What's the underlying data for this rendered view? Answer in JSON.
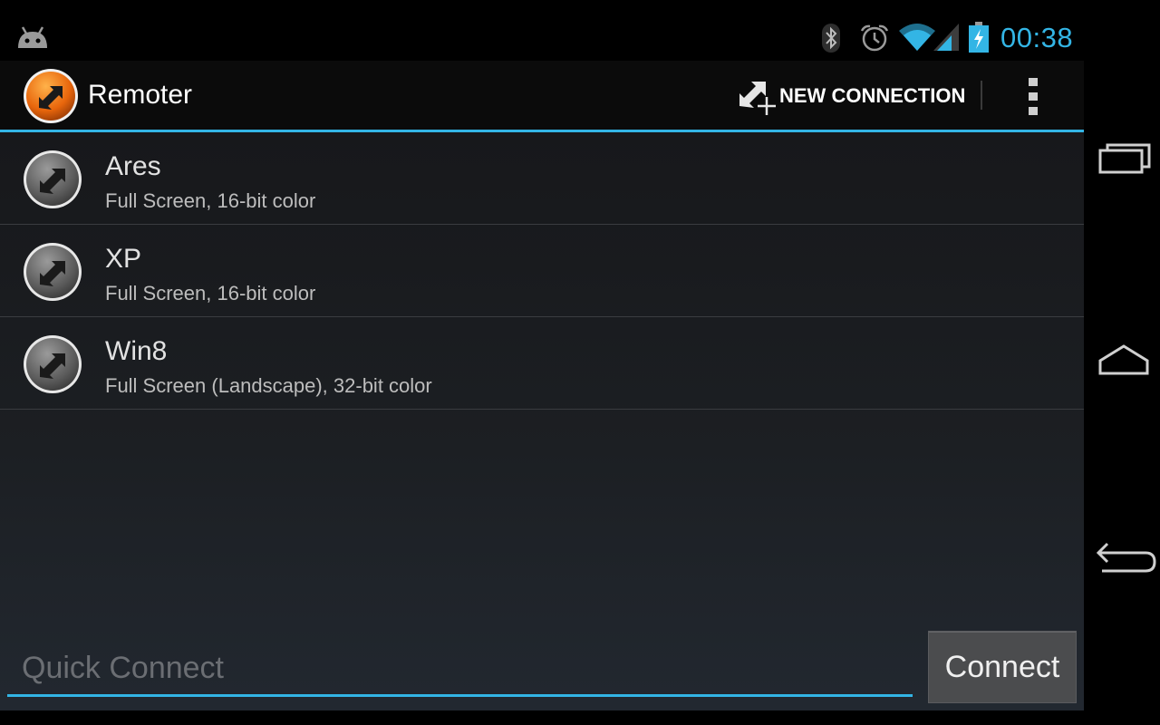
{
  "status_bar": {
    "time": "00:38",
    "icons": [
      "android-icon",
      "bluetooth-icon",
      "alarm-icon",
      "wifi-icon",
      "signal-icon",
      "battery-charging-icon"
    ],
    "accent_color": "#33b5e5"
  },
  "action_bar": {
    "app_title": "Remoter",
    "new_connection_label": "NEW CONNECTION",
    "accent_color": "#33b5e5"
  },
  "connections": [
    {
      "name": "Ares",
      "description": "Full Screen, 16-bit color"
    },
    {
      "name": "XP",
      "description": "Full Screen, 16-bit color"
    },
    {
      "name": "Win8",
      "description": "Full Screen (Landscape), 32-bit color"
    }
  ],
  "quick_connect": {
    "placeholder": "Quick Connect",
    "value": "",
    "button_label": "Connect"
  },
  "nav_bar": {
    "buttons": [
      "recent-apps-icon",
      "home-icon",
      "back-icon"
    ]
  }
}
